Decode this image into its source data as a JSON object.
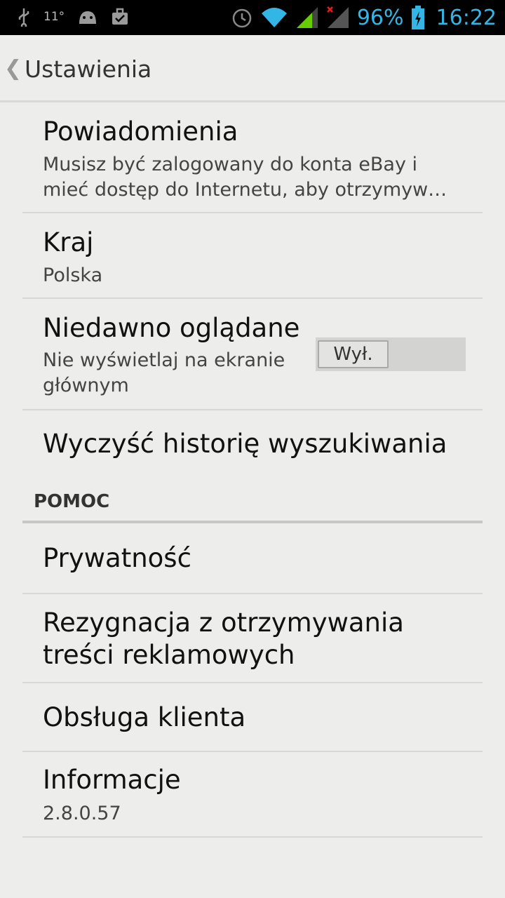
{
  "status_bar": {
    "icons": [
      "usb-icon",
      "weather-icon",
      "android-icon",
      "briefcase-icon",
      "alarm-icon",
      "wifi-icon",
      "signal-icon",
      "no-signal-icon",
      "battery-charging-icon"
    ],
    "temperature": "11°",
    "battery": "96%",
    "time": "16:22",
    "accent": "#33b5e5"
  },
  "action_bar": {
    "title": "Ustawienia"
  },
  "settings": {
    "notifications": {
      "title": "Powiadomienia",
      "line1": "Musisz być zalogowany do konta eBay i",
      "line2": "mieć dostęp do Internetu, aby otrzymyw…"
    },
    "country": {
      "title": "Kraj",
      "value": "Polska"
    },
    "recently_viewed": {
      "title": "Niedawno oglądane",
      "line1": "Nie wyświetlaj na ekranie",
      "line2": "głównym",
      "toggle_label": "Wył."
    },
    "clear_history": {
      "title": "Wyczyść historię wyszukiwania"
    }
  },
  "help": {
    "header": "POMOC",
    "privacy": {
      "title": "Prywatność"
    },
    "opt_out": {
      "line1": "Rezygnacja z otrzymywania",
      "line2": "treści reklamowych"
    },
    "customer_service": {
      "title": "Obsługa klienta"
    },
    "info": {
      "title": "Informacje",
      "version": "2.8.0.57"
    }
  }
}
